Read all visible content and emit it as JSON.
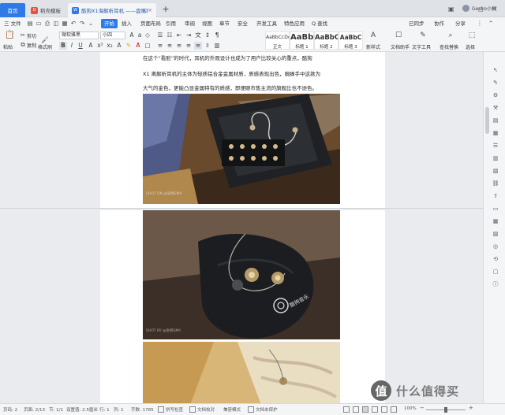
{
  "tabs": {
    "home": "首页",
    "template": "稻壳模板",
    "doc": "酷狗X1海解析耳机 ——盘嘴科技"
  },
  "window": {
    "user": "Geeko小树"
  },
  "menu": {
    "file": "三 文件",
    "items": [
      "开始",
      "插入",
      "页面布局",
      "引用",
      "审阅",
      "视图",
      "章节",
      "安全",
      "开发工具",
      "特色应用"
    ],
    "search": "Q 查找",
    "right": [
      "已同步",
      "协作",
      "分享"
    ]
  },
  "ribbon": {
    "paste": "粘贴",
    "cut": "剪切",
    "copy": "复制",
    "format_painter": "格式刷",
    "font_name": "微软雅黑",
    "font_size": "小四",
    "styles": [
      {
        "sample": "AaBbCcDd",
        "name": "正文"
      },
      {
        "sample": "AaBb",
        "name": "标题 1"
      },
      {
        "sample": "AaBbC",
        "name": "标题 2"
      },
      {
        "sample": "AaBbC",
        "name": "标题 3"
      }
    ],
    "new_style": "新样式",
    "text_assist": "文档助手",
    "text_tools": "文字工具",
    "find_replace": "查找替换",
    "select": "选择"
  },
  "document": {
    "lines": [
      "在这个“看脸”的时代，耳机的外观设计也成为了用户比较关心的重点，酷狗",
      "X1 离解析耳机的主体为轻质铝合金金属材质，质感表现出色，蜘蛛手中这款为",
      "大气的金色，更能凸显金属特有的质感，即便眼市售主流的旗舰比也不逊色。"
    ],
    "photo_watermark_1": "SHOT ON @张悦SMII",
    "photo_watermark_2": "SHOT BY @张悦SMII",
    "pouch_logo": "酷狗音乐"
  },
  "status": {
    "page": "页码: 2",
    "pages": "页面: 2/13",
    "section": "节: 1/1",
    "setting": "设置值: 2.5厘米",
    "row": "行: 1",
    "col": "列: 1",
    "words": "字数: 1785",
    "spell": "拼写检查",
    "proof": "文档校对",
    "compat": "兼容模式",
    "protect": "文档未保护",
    "zoom": "100%",
    "zoom_level": 0.5
  },
  "brand": {
    "mark": "值",
    "text": "什么值得买"
  },
  "colors": {
    "accent": "#2f7ae5",
    "doc_tab_text": "#2a5db0"
  }
}
